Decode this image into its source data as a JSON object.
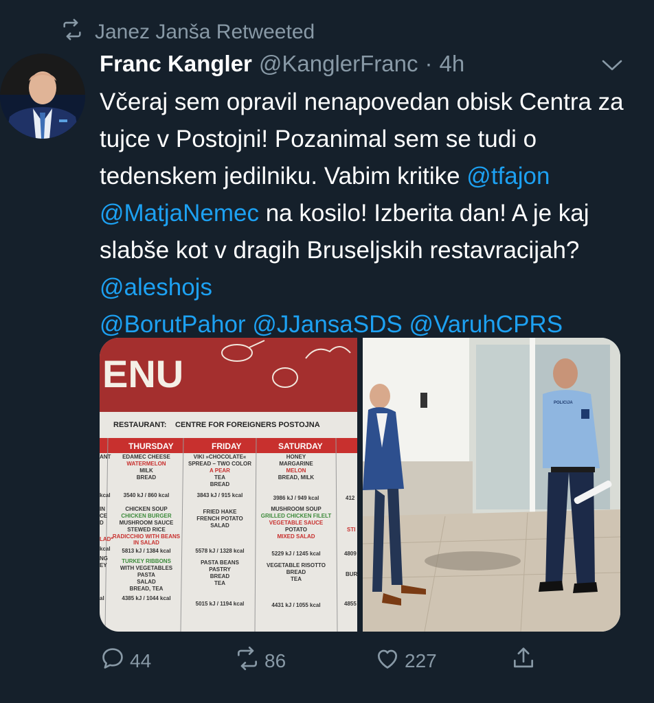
{
  "retweet": {
    "icon": "retweet-icon",
    "label": "Janez Janša Retweeted"
  },
  "author": {
    "name": "Franc Kangler",
    "handle": "@KanglerFranc",
    "separator": "·",
    "time": "4h"
  },
  "tweet": {
    "text_1": "Včeraj sem opravil nenapovedan obisk Centra za tujce v Postojni! Pozanimal sem se tudi o tedenskem  jedilniku. Vabim kritike ",
    "mention_1": "@tfajon",
    "space_1": " ",
    "mention_2": "@MatjaNemec",
    "text_2": " na kosilo! Izberita dan! A je kaj slabše kot v dragih Bruseljskih restavracijah? ",
    "mention_3": "@aleshojs",
    "space_2": " ",
    "mention_4": "@BorutPahor",
    "space_3": " ",
    "mention_5": "@JJansaSDS",
    "space_4": " ",
    "mention_6": "@VaruhCPRS"
  },
  "menu_image": {
    "title": "ENU",
    "restaurant_label": "RESTAURANT:",
    "restaurant_name": "CENTRE FOR FOREIGNERS POSTOJNA",
    "days": [
      "THURSDAY",
      "FRIDAY",
      "SATURDAY"
    ],
    "thursday": {
      "breakfast": [
        "EDAMEC CHEESE",
        "WATERMELON",
        "MILK",
        "BREAD"
      ],
      "breakfast_kcal": "3540 kJ / 860 kcal",
      "lunch": [
        "CHICKEN SOUP",
        "CHICKEN BURGER",
        "MUSHROOM SAUCE",
        "STEWED RICE",
        "RADICCHIO WITH BEANS",
        "IN SALAD"
      ],
      "lunch_kcal": "5813 kJ / 1384 kcal",
      "dinner": [
        "TURKEY RIBBONS",
        "WITH VEGETABLES",
        "PASTA",
        "SALAD",
        "BREAD, TEA"
      ],
      "dinner_kcal": "4385 kJ / 1044 kcal"
    },
    "friday": {
      "breakfast": [
        "VIKI »CHOCOLATE«",
        "SPREAD – TWO COLOR",
        "A PEAR",
        "TEA",
        "BREAD"
      ],
      "breakfast_kcal": "3843 kJ / 915 kcal",
      "lunch": [
        "FRIED HAKE",
        "FRENCH POTATO",
        "SALAD"
      ],
      "lunch_kcal": "5578 kJ / 1328 kcal",
      "dinner": [
        "PASTA BEANS",
        "PASTRY",
        "BREAD",
        "TEA"
      ],
      "dinner_kcal": "5015 kJ / 1194 kcal"
    },
    "saturday": {
      "breakfast": [
        "HONEY",
        "MARGARINE",
        "MELON",
        "BREAD, MILK"
      ],
      "breakfast_kcal": "3986 kJ / 949 kcal",
      "lunch": [
        "MUSHROOM SOUP",
        "GRILLED CHICKEN FILELT",
        "VEGETABLE SAUCE",
        "POTATO",
        "MIXED SALAD"
      ],
      "lunch_kcal": "5229 kJ / 1245 kcal",
      "dinner": [
        "VEGETABLE RISOTTO",
        "BREAD",
        "TEA"
      ],
      "dinner_kcal": "4431 kJ / 1055 kcal"
    },
    "left_edge": [
      "ANT",
      "kcal",
      "IN",
      "CE",
      "D",
      "LAD*",
      "kcal",
      "NG",
      "EY",
      "al"
    ],
    "right_edge": [
      "412",
      "STI",
      "4809",
      "BUR",
      "4855"
    ]
  },
  "photo_image": {
    "badge": "POLICIJA"
  },
  "actions": {
    "reply_icon": "reply-icon",
    "reply_count": "44",
    "retweet_icon": "retweet-icon",
    "retweet_count": "86",
    "like_icon": "heart-icon",
    "like_count": "227",
    "share_icon": "share-icon"
  },
  "colors": {
    "background": "#15202b",
    "text": "#ffffff",
    "muted": "#8899a6",
    "link": "#1da1f2"
  }
}
